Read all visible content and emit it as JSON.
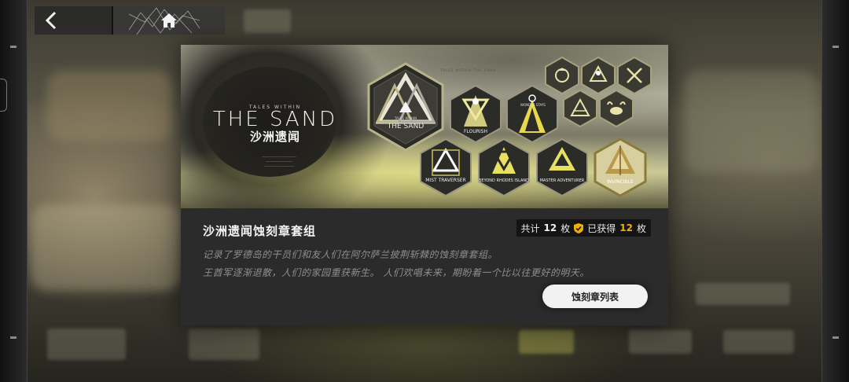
{
  "nav": {
    "back_icon": "chevron-left-icon",
    "home_icon": "home-icon"
  },
  "banner": {
    "logo_small": "TALES WITHIN",
    "logo_main": "THE SAND",
    "logo_cn": "沙洲遗闻",
    "sand_label": "TALES WITHIN THE SAND"
  },
  "medals": [
    {
      "label": "THE SAND",
      "sub": "TALES WITHIN"
    },
    {
      "label": "FLOURISH"
    },
    {
      "label": "WONDER STAYS"
    },
    {
      "label": "MIST TRAVERSER"
    },
    {
      "label": "BEYOND RHODES ISLAND"
    },
    {
      "label": "MASTER ADVENTURER"
    },
    {
      "label": "INVINCIBLE"
    }
  ],
  "modal": {
    "title": "沙洲遗闻蚀刻章套组",
    "counter": {
      "total_label": "共计",
      "total": "12",
      "unit": "枚",
      "obtained_label": "已获得",
      "obtained": "12",
      "unit2": "枚"
    },
    "description_1": "记录了罗德岛的干员们和友人们在阿尔萨兰披荆斩棘的蚀刻章套组。",
    "description_2": "王酋军逐渐退散，人们的家园重获新生。 人们欢唱未来，期盼着一个比以往更好的明天。",
    "list_button": "蚀刻章列表"
  },
  "colors": {
    "accent": "#f0b000",
    "modal_bg": "#2b2b2b"
  }
}
